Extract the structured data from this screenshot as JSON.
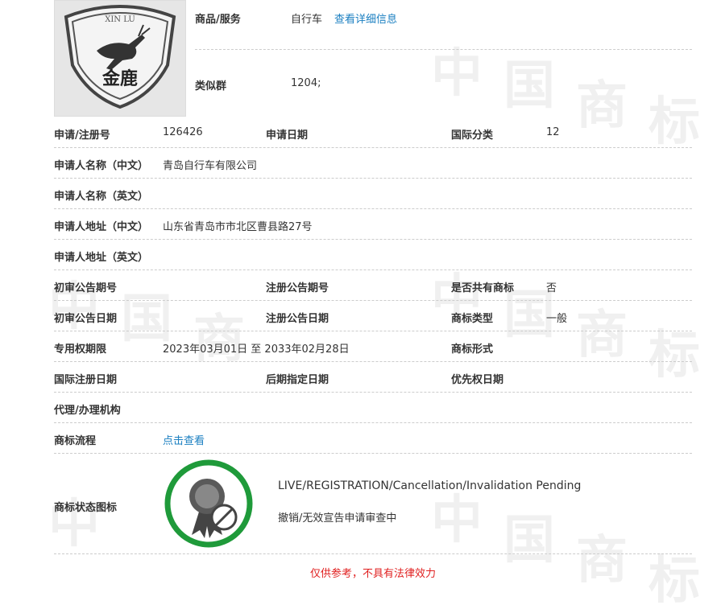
{
  "top": {
    "goods_label": "商品/服务",
    "goods_value": "自行车",
    "goods_link": "查看详细信息",
    "group_label": "类似群",
    "group_value": "1204;"
  },
  "logo": {
    "text_top": "XIN LU",
    "text_bottom": "金鹿"
  },
  "rows": {
    "reg_no_label": "申请/注册号",
    "reg_no_value": "126426",
    "app_date_label": "申请日期",
    "app_date_value": "",
    "intl_class_label": "国际分类",
    "intl_class_value": "12",
    "name_cn_label": "申请人名称（中文）",
    "name_cn_value": "青岛自行车有限公司",
    "name_en_label": "申请人名称（英文）",
    "name_en_value": "",
    "addr_cn_label": "申请人地址（中文）",
    "addr_cn_value": "山东省青岛市市北区曹县路27号",
    "addr_en_label": "申请人地址（英文）",
    "addr_en_value": "",
    "prelim_no_label": "初审公告期号",
    "prelim_no_value": "",
    "reg_pub_no_label": "注册公告期号",
    "reg_pub_no_value": "",
    "shared_label": "是否共有商标",
    "shared_value": "否",
    "prelim_date_label": "初审公告日期",
    "prelim_date_value": "",
    "reg_pub_date_label": "注册公告日期",
    "reg_pub_date_value": "",
    "tm_type_label": "商标类型",
    "tm_type_value": "一般",
    "term_label": "专用权期限",
    "term_value": "2023年03月01日 至 2033年02月28日",
    "tm_form_label": "商标形式",
    "tm_form_value": "",
    "intl_reg_date_label": "国际注册日期",
    "intl_reg_date_value": "",
    "later_date_label": "后期指定日期",
    "later_date_value": "",
    "priority_label": "优先权日期",
    "priority_value": "",
    "agent_label": "代理/办理机构",
    "agent_value": "",
    "process_label": "商标流程",
    "process_link": "点击查看",
    "status_label": "商标状态图标",
    "status_en": "LIVE/REGISTRATION/Cancellation/Invalidation Pending",
    "status_cn": "撤销/无效宣告申请审查中"
  },
  "disclaimer": "仅供参考，不具有法律效力",
  "colors": {
    "link": "#1a7fc1",
    "status_ring": "#1f9a3a",
    "disclaimer": "#e02020"
  }
}
